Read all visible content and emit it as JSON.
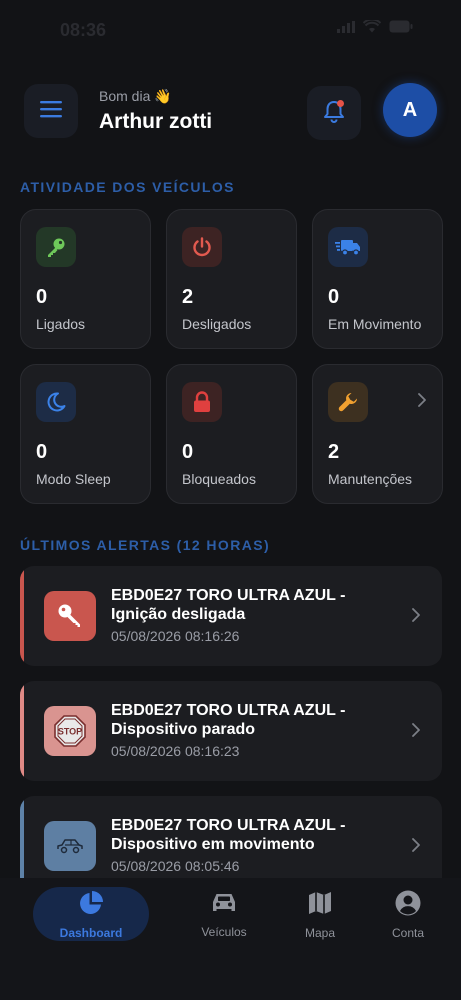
{
  "status_bar": {
    "time": "08:36"
  },
  "header": {
    "greeting": "Bom dia 👋",
    "username": "Arthur zotti",
    "avatar_initial": "A"
  },
  "activity": {
    "title": "ATIVIDADE DOS VEÍCULOS",
    "cards": [
      {
        "value": "0",
        "label": "Ligados",
        "icon": "key-icon",
        "color": "#6ec85a",
        "bg": "#233827"
      },
      {
        "value": "2",
        "label": "Desligados",
        "icon": "power-icon",
        "color": "#e35a4f",
        "bg": "#3d2323"
      },
      {
        "value": "0",
        "label": "Em Movimento",
        "icon": "truck-icon",
        "color": "#3b82e8",
        "bg": "#1d2c46"
      },
      {
        "value": "0",
        "label": "Modo Sleep",
        "icon": "moon-icon",
        "color": "#3b82e8",
        "bg": "#1d2c46"
      },
      {
        "value": "0",
        "label": "Bloqueados",
        "icon": "lock-icon",
        "color": "#e0403f",
        "bg": "#3d2323"
      },
      {
        "value": "2",
        "label": "Manutenções",
        "icon": "wrench-icon",
        "color": "#f0a030",
        "bg": "#3d3020"
      }
    ]
  },
  "alerts": {
    "title": "ÚLTIMOS ALERTAS (12 HORAS)",
    "items": [
      {
        "title": "EBD0E27 TORO ULTRA AZUL - Ignição desligada",
        "time": "05/08/2026 08:16:26",
        "icon": "key-icon",
        "accent": "#c9564e",
        "icon_bg": "#c9564e"
      },
      {
        "title": "EBD0E27 TORO ULTRA AZUL - Dispositivo parado",
        "time": "05/08/2026 08:16:23",
        "icon": "stop-sign-icon",
        "accent": "#e08a86",
        "icon_bg": "#d99490",
        "stop_text": "STOP"
      },
      {
        "title": "EBD0E27 TORO ULTRA AZUL - Dispositivo em movimento",
        "time": "05/08/2026 08:05:46",
        "icon": "car-icon",
        "accent": "#5e82a8",
        "icon_bg": "#5e7fa3"
      }
    ]
  },
  "tabbar": {
    "tabs": [
      {
        "label": "Dashboard",
        "icon": "pie-chart-icon",
        "active": true
      },
      {
        "label": "Veículos",
        "icon": "car-icon"
      },
      {
        "label": "Mapa",
        "icon": "map-icon"
      },
      {
        "label": "Conta",
        "icon": "account-icon"
      }
    ]
  }
}
